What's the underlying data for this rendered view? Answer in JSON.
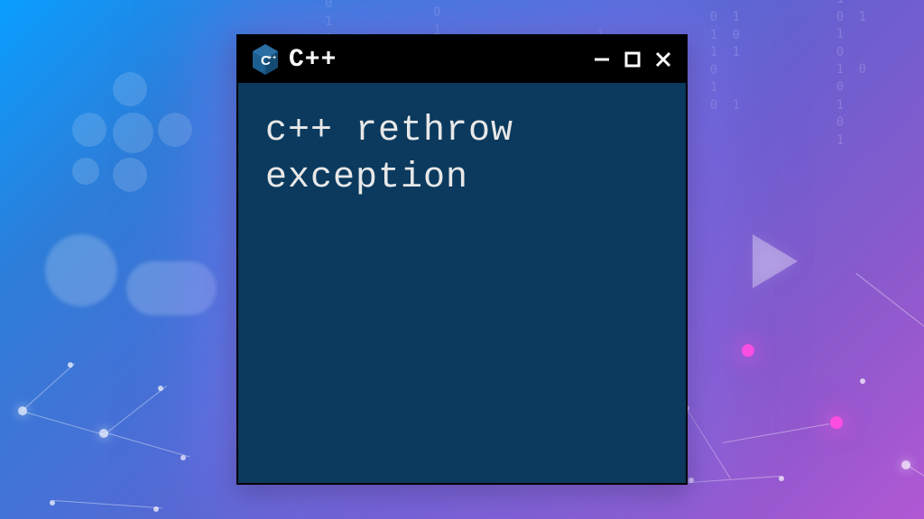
{
  "window": {
    "title": "C++",
    "icon_name": "cpp-logo-icon"
  },
  "terminal": {
    "content_line1": "c++ rethrow",
    "content_line2": "exception"
  }
}
